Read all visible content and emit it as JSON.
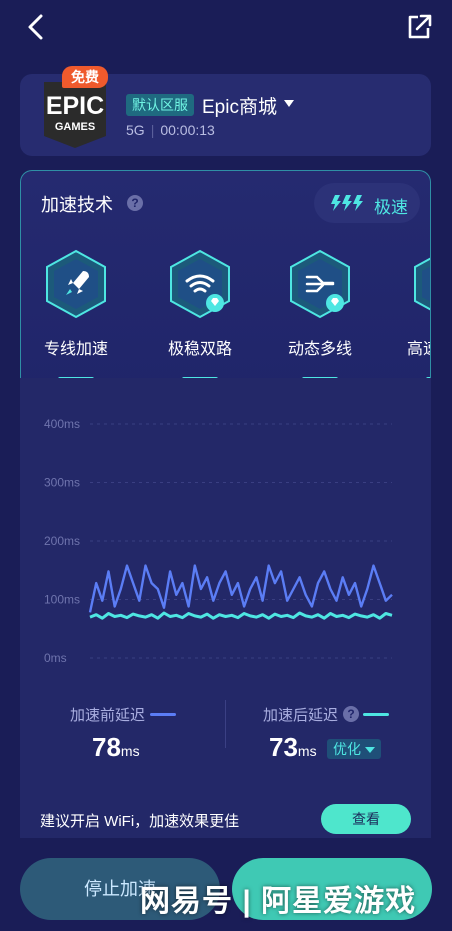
{
  "game": {
    "free_badge": "免费",
    "region_tag": "默认区服",
    "name": "Epic商城",
    "network": "5G",
    "elapsed": "00:00:13",
    "logo_text": "EPIC GAMES"
  },
  "tech": {
    "title": "加速技术",
    "help": "?",
    "mode": "极速",
    "items": [
      {
        "label": "专线加速",
        "icon": "rocket-icon"
      },
      {
        "label": "极稳双路",
        "icon": "dual-wifi-icon"
      },
      {
        "label": "动态多线",
        "icon": "multiline-icon"
      },
      {
        "label": "高速",
        "icon": "highspeed-icon"
      }
    ]
  },
  "chart_data": {
    "type": "line",
    "ytick_labels": [
      "400ms",
      "300ms",
      "200ms",
      "100ms",
      "0ms"
    ],
    "ylim": [
      0,
      400
    ],
    "grid": true,
    "series": [
      {
        "name": "加速前延迟",
        "color": "#5b7df5",
        "values": [
          78,
          128,
          98,
          148,
          88,
          118,
          158,
          128,
          98,
          158,
          128,
          118,
          86,
          148,
          108,
          128,
          88,
          158,
          118,
          138,
          98,
          128,
          148,
          108,
          128,
          88,
          118,
          138,
          98,
          158,
          128,
          148,
          98,
          118,
          138,
          108,
          88,
          128,
          148,
          118,
          98,
          138,
          108,
          128,
          88,
          118,
          158,
          128,
          98,
          108
        ]
      },
      {
        "name": "加速后延迟",
        "color": "#4ee6e2",
        "values": [
          70,
          74,
          68,
          76,
          71,
          73,
          69,
          75,
          72,
          70,
          74,
          68,
          77,
          71,
          73,
          69,
          76,
          72,
          70,
          75,
          68,
          74,
          71,
          73,
          69,
          76,
          72,
          70,
          74,
          68,
          75,
          71,
          73,
          69,
          77,
          72,
          70,
          74,
          68,
          76,
          71,
          73,
          69,
          75,
          72,
          70,
          74,
          68,
          76,
          73
        ]
      }
    ]
  },
  "stats": {
    "before_label": "加速前延迟",
    "before_value": "78",
    "after_label": "加速后延迟",
    "after_value": "73",
    "unit": "ms",
    "optimize": "优化"
  },
  "tip": {
    "text": "建议开启 WiFi，加速效果更佳",
    "button": "查看"
  },
  "bottom": {
    "stop_label": "停止加速",
    "watermark": "网易号 | 阿星爱游戏"
  }
}
